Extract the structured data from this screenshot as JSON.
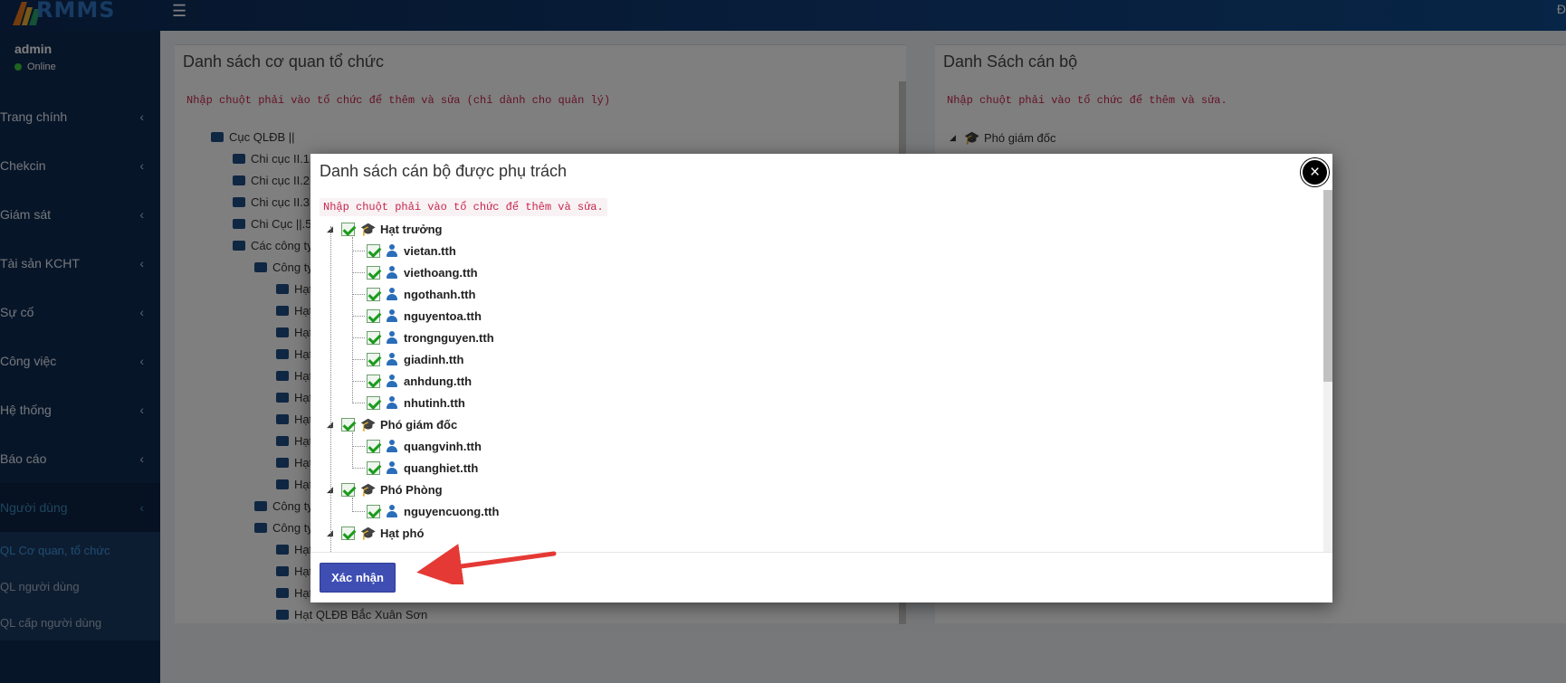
{
  "app": {
    "logo_text": "RMMS",
    "topbar_edge": "Đ"
  },
  "sidebar": {
    "user": {
      "name": "admin",
      "status": "Online"
    },
    "menu": [
      {
        "label": "Trang chính"
      },
      {
        "label": "Chekcin"
      },
      {
        "label": "Giám sát"
      },
      {
        "label": "Tài sản KCHT"
      },
      {
        "label": "Sự cố"
      },
      {
        "label": "Công việc"
      },
      {
        "label": "Hệ thống"
      },
      {
        "label": "Báo cáo"
      },
      {
        "label": "Người dùng"
      }
    ],
    "submenu": [
      {
        "label": "QL Cơ quan, tổ chức"
      },
      {
        "label": "QL người dùng"
      },
      {
        "label": "QL cấp người dùng"
      }
    ]
  },
  "left_panel": {
    "title": "Danh sách cơ quan tổ chức",
    "hint": "Nhập chuột phải vào tổ chức để thêm và sửa (chỉ dành cho quản lý)",
    "tree": [
      "Cục QLĐB ||",
      "Chi cục II.1",
      "Chi cục II.2",
      "Chi cục II.3",
      "Chi Cục ||.5",
      "Các công ty",
      "Công ty",
      "Hạt",
      "Hạt",
      "Hạt",
      "Hạt",
      "Hạt",
      "Hạt",
      "Hạt",
      "Hạt",
      "Hạt",
      "Hạt",
      "Công ty",
      "Công ty",
      "Hạt",
      "Hạt",
      "Hạt",
      "Hạt QLĐB Bắc Xuân Sơn"
    ]
  },
  "right_panel": {
    "title": "Danh Sách cán bộ",
    "hint": "Nhập chuột phải vào tổ chức để thêm và sửa.",
    "tree": [
      "Phó giám đốc"
    ]
  },
  "modal": {
    "title": "Danh sách cán bộ được phụ trách",
    "close": "×",
    "hint": "Nhập chuột phải vào tổ chức để thêm và sửa.",
    "groups": [
      {
        "label": "Hạt trưởng",
        "users": [
          "vietan.tth",
          "viethoang.tth",
          "ngothanh.tth",
          "nguyentoa.tth",
          "trongnguyen.tth",
          "giadinh.tth",
          "anhdung.tth",
          "nhutinh.tth"
        ]
      },
      {
        "label": "Phó giám đốc",
        "users": [
          "quangvinh.tth",
          "quanghiet.tth"
        ]
      },
      {
        "label": "Phó Phòng",
        "users": [
          "nguyencuong.tth"
        ]
      },
      {
        "label": "Hạt phó",
        "users": []
      }
    ],
    "confirm_label": "Xác nhận"
  },
  "annotation": {
    "arrow_color": "#e53935"
  }
}
